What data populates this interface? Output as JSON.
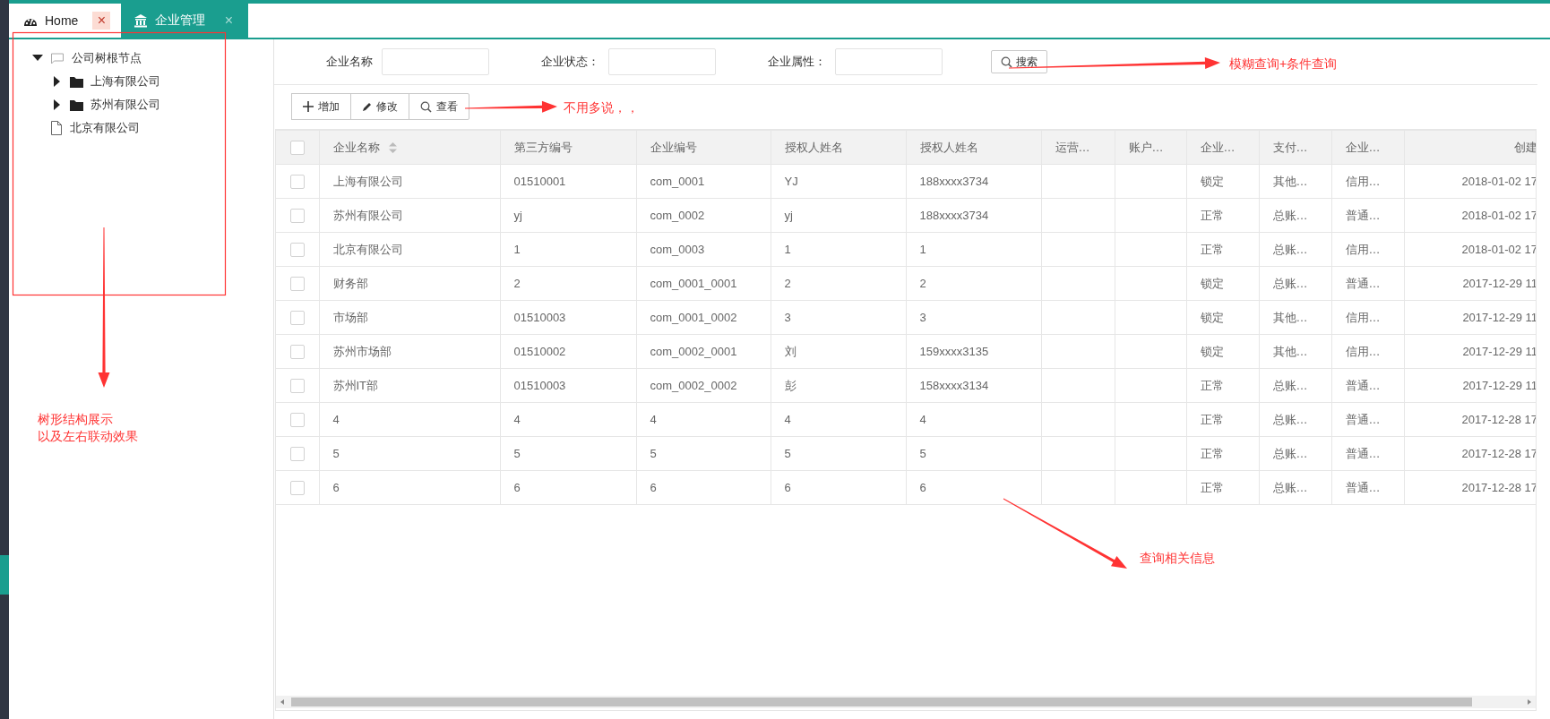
{
  "tabs": [
    {
      "label": "Home",
      "close": "×",
      "selected": false
    },
    {
      "label": "企业管理",
      "close": "×",
      "selected": true
    }
  ],
  "tree": [
    {
      "label": "公司树根节点",
      "kind": "root",
      "expanded": true,
      "children": [
        {
          "label": "上海有限公司",
          "kind": "folder",
          "expanded": false
        },
        {
          "label": "苏州有限公司",
          "kind": "folder",
          "expanded": false
        }
      ]
    },
    {
      "label": "北京有限公司",
      "kind": "file"
    }
  ],
  "search": {
    "fields": [
      {
        "label": "企业名称"
      },
      {
        "label": "企业状态："
      },
      {
        "label": "企业属性："
      }
    ],
    "button": "搜索"
  },
  "toolbar": [
    {
      "label": "增加"
    },
    {
      "label": "修改"
    },
    {
      "label": "查看"
    }
  ],
  "table": {
    "all_checked": false,
    "columns": [
      {
        "label": "企业名称",
        "sortable": true
      },
      {
        "label": "第三方编号",
        "sortable": false
      },
      {
        "label": "企业编号",
        "sortable": false
      },
      {
        "label": "授权人姓名",
        "sortable": false
      },
      {
        "label": "授权人姓名",
        "sortable": false
      },
      {
        "label": "运营…",
        "sortable": false
      },
      {
        "label": "账户…",
        "sortable": false
      },
      {
        "label": "企业…",
        "sortable": false
      },
      {
        "label": "支付…",
        "sortable": false
      },
      {
        "label": "企业…",
        "sortable": false
      },
      {
        "label": "创建",
        "sortable": false
      }
    ],
    "rows": [
      {
        "checked": false,
        "cells": [
          "上海有限公司",
          "01510001",
          "com_0001",
          "YJ",
          "188xxxx3734",
          "",
          "",
          "锁定",
          "其他…",
          "信用…",
          "2018-01-02 17"
        ]
      },
      {
        "checked": false,
        "cells": [
          "苏州有限公司",
          "yj",
          "com_0002",
          "yj",
          "188xxxx3734",
          "",
          "",
          "正常",
          "总账…",
          "普通…",
          "2018-01-02 17"
        ]
      },
      {
        "checked": false,
        "cells": [
          "北京有限公司",
          "1",
          "com_0003",
          "1",
          "1",
          "",
          "",
          "正常",
          "总账…",
          "信用…",
          "2018-01-02 17"
        ]
      },
      {
        "checked": false,
        "cells": [
          "财务部",
          "2",
          "com_0001_0001",
          "2",
          "2",
          "",
          "",
          "锁定",
          "总账…",
          "普通…",
          "2017-12-29 11"
        ]
      },
      {
        "checked": false,
        "cells": [
          "市场部",
          "01510003",
          "com_0001_0002",
          "3",
          "3",
          "",
          "",
          "锁定",
          "其他…",
          "信用…",
          "2017-12-29 11"
        ]
      },
      {
        "checked": false,
        "cells": [
          "苏州市场部",
          "01510002",
          "com_0002_0001",
          "刘",
          "159xxxx3135",
          "",
          "",
          "锁定",
          "其他…",
          "信用…",
          "2017-12-29 11"
        ]
      },
      {
        "checked": false,
        "cells": [
          "苏州IT部",
          "01510003",
          "com_0002_0002",
          "彭",
          "158xxxx3134",
          "",
          "",
          "正常",
          "总账…",
          "普通…",
          "2017-12-29 11"
        ]
      },
      {
        "checked": false,
        "cells": [
          "4",
          "4",
          "4",
          "4",
          "4",
          "",
          "",
          "正常",
          "总账…",
          "普通…",
          "2017-12-28 17"
        ]
      },
      {
        "checked": false,
        "cells": [
          "5",
          "5",
          "5",
          "5",
          "5",
          "",
          "",
          "正常",
          "总账…",
          "普通…",
          "2017-12-28 17"
        ]
      },
      {
        "checked": false,
        "cells": [
          "6",
          "6",
          "6",
          "6",
          "6",
          "",
          "",
          "正常",
          "总账…",
          "普通…",
          "2017-12-28 17"
        ]
      }
    ]
  },
  "annotations": [
    {
      "lines": [
        "模糊查询+条件查询"
      ]
    },
    {
      "lines": [
        "不用多说，，"
      ]
    },
    {
      "lines": [
        "树形结构展示",
        "以及左右联动效果"
      ]
    },
    {
      "lines": [
        "查询相关信息"
      ]
    }
  ]
}
